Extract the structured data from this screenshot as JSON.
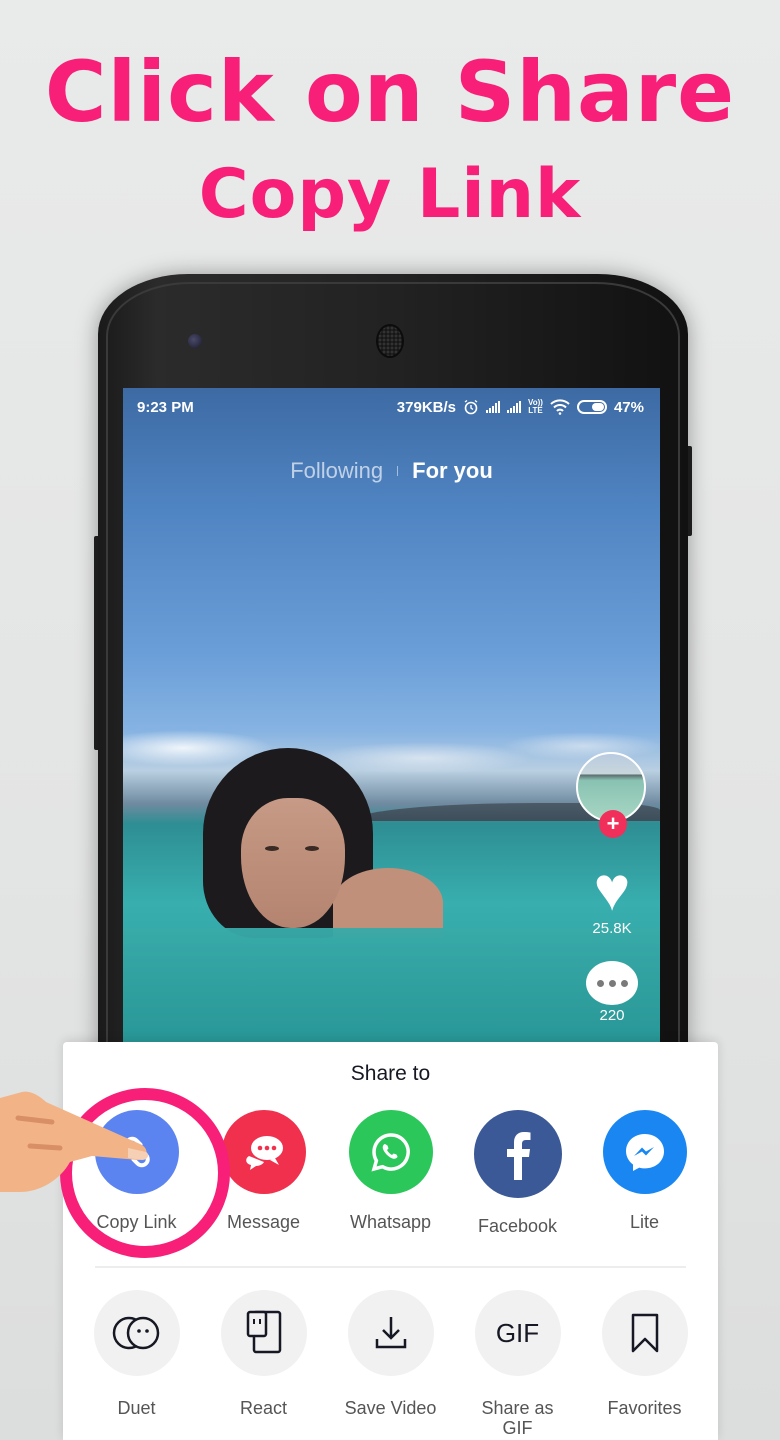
{
  "headline": {
    "line1": "Click on Share",
    "line2": "Copy Link",
    "color": "#f71f78"
  },
  "status_bar": {
    "time": "9:23 PM",
    "net_speed": "379KB/s",
    "icons": [
      "alarm-icon",
      "signal-icon",
      "signal-icon",
      "volte-icon",
      "wifi-icon",
      "battery-icon"
    ],
    "volte_line1": "Vo))",
    "volte_line2": "LTE",
    "battery_pct": "47%"
  },
  "feed": {
    "tabs": [
      {
        "label": "Following",
        "active": false
      },
      {
        "label": "For you",
        "active": true
      }
    ],
    "follow_icon": "+",
    "likes": "25.8K",
    "comments": "220"
  },
  "share_sheet": {
    "title": "Share to",
    "primary": [
      {
        "label": "Copy Link",
        "icon": "link-icon",
        "color": "#5b84f0"
      },
      {
        "label": "Message",
        "icon": "message-icon",
        "color": "#f0304d"
      },
      {
        "label": "Whatsapp",
        "icon": "whatsapp-icon",
        "color": "#2cc75a"
      },
      {
        "label": "Facebook",
        "icon": "facebook-icon",
        "color": "#3b5897"
      },
      {
        "label": "Lite",
        "icon": "messenger-icon",
        "color": "#1a86f2"
      }
    ],
    "secondary": [
      {
        "label": "Duet",
        "icon": "duet-icon"
      },
      {
        "label": "React",
        "icon": "react-icon"
      },
      {
        "label": "Save Video",
        "icon": "download-icon"
      },
      {
        "label": "Share as GIF",
        "icon": "gif-icon",
        "glyph": "GIF"
      },
      {
        "label": "Favorites",
        "icon": "bookmark-icon"
      }
    ]
  }
}
